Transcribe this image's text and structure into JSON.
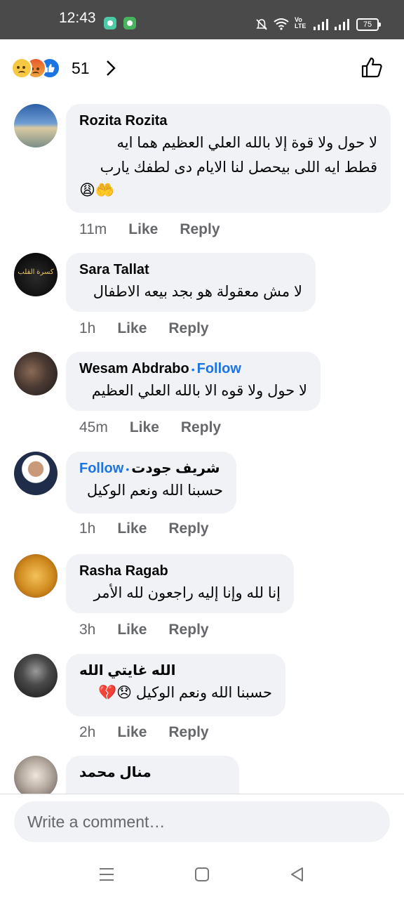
{
  "status_bar": {
    "time": "12:43",
    "battery": "75"
  },
  "header": {
    "reaction_count": "51"
  },
  "comments": [
    {
      "name": "Rozita Rozita",
      "follow": "",
      "lines": [
        "لا حول ولا قوة إلا بالله العلي العظيم هما ايه",
        "قطط ايه اللى بيحصل لنا الايام دى لطفك يارب"
      ],
      "emoji": "😩🤲",
      "time": "11m",
      "like": "Like",
      "reply": "Reply"
    },
    {
      "name": "Sara Tallat",
      "follow": "",
      "lines": [
        "لا مش معقولة هو بجد بيعه الاطفال"
      ],
      "emoji": "",
      "time": "1h",
      "like": "Like",
      "reply": "Reply"
    },
    {
      "name": "Wesam Abdrabo",
      "follow": "Follow",
      "lines": [
        "لا حول ولا قوه الا بالله العلي العظيم"
      ],
      "emoji": "",
      "time": "45m",
      "like": "Like",
      "reply": "Reply"
    },
    {
      "name": "شريف جودت",
      "follow": "Follow",
      "lines": [
        "حسبنا الله ونعم الوكيل"
      ],
      "emoji": "",
      "time": "1h",
      "like": "Like",
      "reply": "Reply"
    },
    {
      "name": "Rasha Ragab",
      "follow": "",
      "lines": [
        "إنا لله وإنا إليه راجعون  لله الأمر"
      ],
      "emoji": "",
      "time": "3h",
      "like": "Like",
      "reply": "Reply"
    },
    {
      "name": "الله غايتي الله",
      "follow": "",
      "lines": [
        "حسبنا الله ونعم الوكيل 😞💔"
      ],
      "emoji": "",
      "time": "2h",
      "like": "Like",
      "reply": "Reply"
    },
    {
      "name": "منال محمد",
      "follow": "",
      "lines": [],
      "emoji": "",
      "time": "",
      "like": "",
      "reply": ""
    }
  ],
  "avatar_overlay_text": "كسرة القلب",
  "composer": {
    "placeholder": "Write a comment…"
  },
  "icons": {
    "reactions": [
      "sad-reaction-icon",
      "angry-reaction-icon",
      "like-reaction-icon"
    ],
    "header": [
      "chevron-right-icon",
      "thumbs-up-icon"
    ],
    "nav": [
      "menu-icon",
      "home-square-icon",
      "back-triangle-icon"
    ]
  },
  "colors": {
    "accent": "#1b74e4",
    "bubble": "#f0f2f5",
    "meta": "#65676b"
  }
}
